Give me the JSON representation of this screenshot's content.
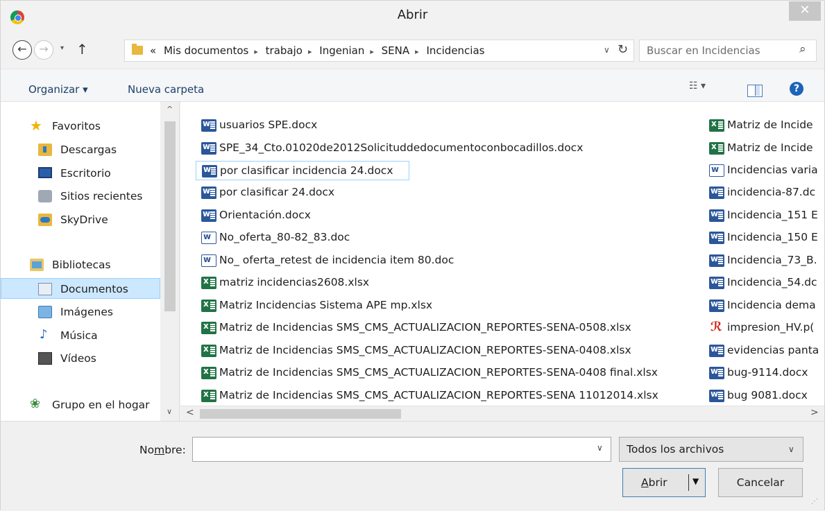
{
  "window": {
    "title": "Abrir",
    "close_glyph": "✕"
  },
  "nav": {
    "back_glyph": "←",
    "forward_glyph": "→",
    "recent_glyph": "▾",
    "up_glyph": "↑"
  },
  "address": {
    "overflow": "«",
    "crumbs": [
      "Mis documentos",
      "trabajo",
      "Ingenian",
      "SENA",
      "Incidencias"
    ],
    "separator": "▸",
    "dropdown_glyph": "∨",
    "refresh_glyph": "↻"
  },
  "search": {
    "placeholder": "Buscar en Incidencias",
    "icon_glyph": "⌕"
  },
  "toolbar": {
    "organize_label": "Organizar ▾",
    "new_folder_label": "Nueva carpeta",
    "view_glyph": "☷ ▾",
    "help_glyph": "?"
  },
  "sidebar": {
    "items": [
      {
        "label": "Favoritos",
        "icon": "star-icon"
      },
      {
        "label": "Descargas",
        "icon": "downloads-icon"
      },
      {
        "label": "Escritorio",
        "icon": "desktop-icon"
      },
      {
        "label": "Sitios recientes",
        "icon": "recent-places-icon"
      },
      {
        "label": "SkyDrive",
        "icon": "skydrive-icon"
      },
      {
        "label": "Bibliotecas",
        "icon": "libraries-icon"
      },
      {
        "label": "Documentos",
        "icon": "documents-icon",
        "selected": true
      },
      {
        "label": "Imágenes",
        "icon": "pictures-icon"
      },
      {
        "label": "Música",
        "icon": "music-icon"
      },
      {
        "label": "Vídeos",
        "icon": "videos-icon"
      },
      {
        "label": "Grupo en el hogar",
        "icon": "homegroup-icon"
      }
    ],
    "scroll_up_glyph": "^",
    "scroll_down_glyph": "∨"
  },
  "files": {
    "column1": [
      {
        "name": "usuarios SPE.docx",
        "type": "docx"
      },
      {
        "name": "SPE_34_Cto.01020de2012Solicituddedocumentoconbocadillos.docx",
        "type": "docx"
      },
      {
        "name": "por clasificar incidencia 24.docx",
        "type": "docx",
        "selected": true
      },
      {
        "name": "por clasificar 24.docx",
        "type": "docx"
      },
      {
        "name": "Orientación.docx",
        "type": "docx"
      },
      {
        "name": "No_oferta_80-82_83.doc",
        "type": "doc"
      },
      {
        "name": "No_ oferta_retest de incidencia item 80.doc",
        "type": "doc"
      },
      {
        "name": "matriz incidencias2608.xlsx",
        "type": "xlsx"
      },
      {
        "name": "Matriz Incidencias Sistema APE mp.xlsx",
        "type": "xlsx"
      },
      {
        "name": "Matriz de Incidencias SMS_CMS_ACTUALIZACION_REPORTES-SENA-0508.xlsx",
        "type": "xlsx"
      },
      {
        "name": "Matriz de Incidencias SMS_CMS_ACTUALIZACION_REPORTES-SENA-0408.xlsx",
        "type": "xlsx"
      },
      {
        "name": "Matriz de Incidencias SMS_CMS_ACTUALIZACION_REPORTES-SENA-0408 final.xlsx",
        "type": "xlsx"
      },
      {
        "name": "Matriz de Incidencias SMS_CMS_ACTUALIZACION_REPORTES-SENA 11012014.xlsx",
        "type": "xlsx"
      }
    ],
    "column2": [
      {
        "name": "Matriz de Incide",
        "type": "xlsx"
      },
      {
        "name": "Matriz de Incide",
        "type": "xlsx"
      },
      {
        "name": "Incidencias varia",
        "type": "doc"
      },
      {
        "name": "incidencia-87.dc",
        "type": "docx"
      },
      {
        "name": "Incidencia_151 E",
        "type": "docx"
      },
      {
        "name": "Incidencia_150 E",
        "type": "docx"
      },
      {
        "name": "Incidencia_73_B.",
        "type": "docx"
      },
      {
        "name": "Incidencia_54.dc",
        "type": "docx"
      },
      {
        "name": "Incidencia dema",
        "type": "docx"
      },
      {
        "name": "impresion_HV.p(",
        "type": "pdf"
      },
      {
        "name": "evidencias panta",
        "type": "docx"
      },
      {
        "name": "bug-9114.docx",
        "type": "docx"
      },
      {
        "name": "bug 9081.docx",
        "type": "docx"
      }
    ],
    "hscroll_left_glyph": "<",
    "hscroll_right_glyph": ">"
  },
  "footer": {
    "name_label_pre": "No",
    "name_label_ul": "m",
    "name_label_post": "bre:",
    "name_value": "",
    "name_dropdown_glyph": "∨",
    "filter_value": "Todos los archivos",
    "filter_dropdown_glyph": "∨",
    "open_label_ul": "A",
    "open_label_post": "brir",
    "open_dropdown_glyph": "▼",
    "cancel_label": "Cancelar"
  }
}
